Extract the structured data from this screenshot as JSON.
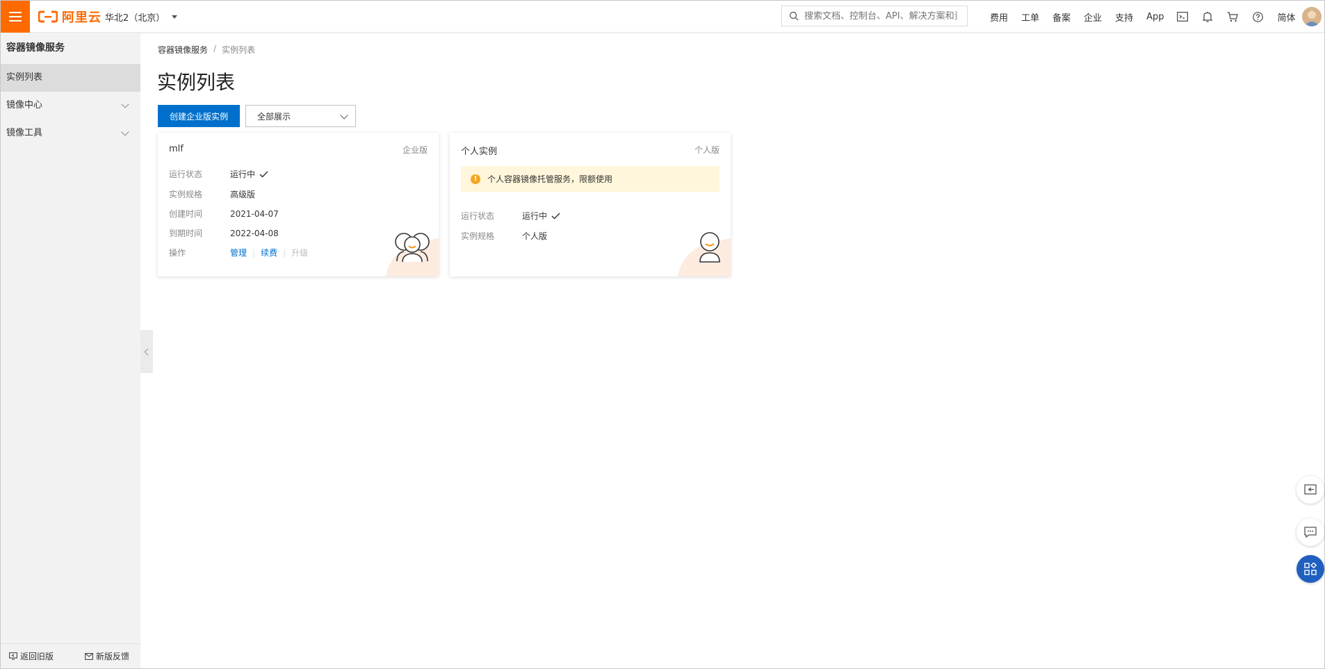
{
  "topbar": {
    "logo_text": "阿里云",
    "region": "华北2（北京）",
    "search_placeholder": "搜索文档、控制台、API、解决方案和资",
    "nav_items": [
      "费用",
      "工单",
      "备案",
      "企业",
      "支持",
      "App"
    ],
    "language": "简体",
    "icons": [
      "terminal-icon",
      "bell-icon",
      "cart-icon",
      "help-icon"
    ]
  },
  "sidebar": {
    "title": "容器镜像服务",
    "items": [
      {
        "label": "实例列表",
        "active": true
      },
      {
        "label": "镜像中心",
        "expandable": true
      },
      {
        "label": "镜像工具",
        "expandable": true
      }
    ],
    "footer": {
      "back_label": "返回旧版",
      "feedback_label": "新版反馈"
    }
  },
  "breadcrumb": {
    "root": "容器镜像服务",
    "sep": "/",
    "current": "实例列表"
  },
  "page_title": "实例列表",
  "toolbar": {
    "create_label": "创建企业版实例",
    "filter_value": "全部展示"
  },
  "cards": [
    {
      "name": "mlf",
      "tier": "企业版",
      "rows": {
        "status_key": "运行状态",
        "status_val": "运行中",
        "spec_key": "实例规格",
        "spec_val": "高级版",
        "created_key": "创建时间",
        "created_val": "2021-04-07",
        "expire_key": "到期时间",
        "expire_val": "2022-04-08",
        "ops_key": "操作"
      },
      "actions": {
        "manage": "管理",
        "renew": "续费",
        "upgrade": "升级"
      }
    },
    {
      "name": "个人实例",
      "tier": "个人版",
      "notice": "个人容器镜像托管服务，限额使用",
      "rows": {
        "status_key": "运行状态",
        "status_val": "运行中",
        "spec_key": "实例规格",
        "spec_val": "个人版"
      }
    }
  ],
  "colors": {
    "brand": "#ff6a00",
    "primary": "#0070cc",
    "notice_bg": "#fff6db",
    "warn": "#f5a623"
  }
}
